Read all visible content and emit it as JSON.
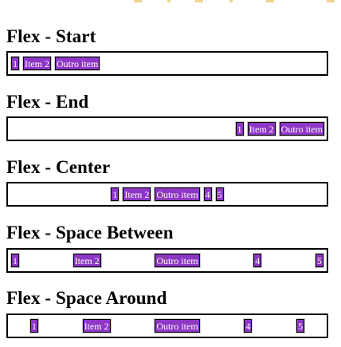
{
  "sections": [
    {
      "title": "Flex - Start",
      "items": [
        "1",
        "Item 2",
        "Outro item"
      ]
    },
    {
      "title": "Flex - End",
      "items": [
        "1",
        "Item 2",
        "Outro item"
      ]
    },
    {
      "title": "Flex - Center",
      "items": [
        "1",
        "Item 2",
        "Outro item",
        "4",
        "5"
      ]
    },
    {
      "title": "Flex - Space Between",
      "items": [
        "1",
        "Item 2",
        "Outro item",
        "4",
        "5"
      ]
    },
    {
      "title": "Flex - Space Around",
      "items": [
        "1",
        "Item 2",
        "Outro item",
        "4",
        "5"
      ]
    }
  ],
  "colors": {
    "item_background": "#8e36c6",
    "item_text": "#ffffff",
    "container_border": "#000000",
    "top_strip": "#f1d38e"
  }
}
